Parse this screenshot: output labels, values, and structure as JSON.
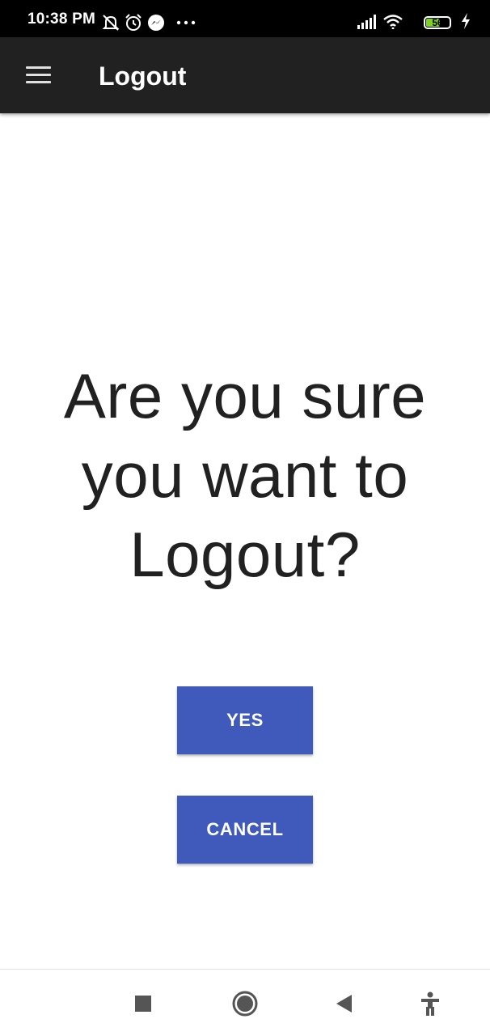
{
  "status_bar": {
    "time": "10:38 PM",
    "icons_left": [
      "bell-off-icon",
      "alarm-icon",
      "messenger-icon",
      "more-dots-icon"
    ],
    "icons_right": [
      "signal-icon",
      "wifi-icon",
      "battery-icon",
      "charging-icon"
    ],
    "battery_level": "56"
  },
  "app_bar": {
    "menu_icon": "hamburger-menu-icon",
    "title": "Logout"
  },
  "dialog": {
    "question_lines": [
      "Are you sure",
      "you want to",
      "Logout?"
    ],
    "yes_label": "YES",
    "cancel_label": "CANCEL"
  },
  "nav_bar": {
    "icons": [
      "recents-square-icon",
      "home-circle-icon",
      "back-triangle-icon",
      "accessibility-icon"
    ]
  },
  "colors": {
    "status_bar_bg": "#000000",
    "app_bar_bg": "#212121",
    "button_bg": "#3f5abb",
    "text": "#212121",
    "battery_fill": "#7ed321"
  }
}
